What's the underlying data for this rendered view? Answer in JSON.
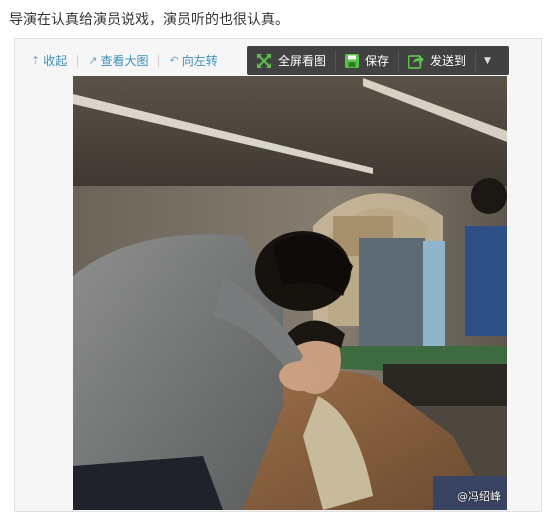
{
  "post": {
    "caption": "导演在认真给演员说戏，演员听的也很认真。"
  },
  "toolbar": {
    "collapse_label": "收起",
    "view_large_label": "查看大图",
    "rotate_left_label": "向左转",
    "fullscreen_label": "全屏看图",
    "save_label": "保存",
    "send_to_label": "发送到"
  },
  "photo": {
    "watermark": "@冯绍峰"
  },
  "colors": {
    "link": "#3b8fbd",
    "toolbar_bg": "#282828",
    "icon_green": "#4cae38"
  }
}
